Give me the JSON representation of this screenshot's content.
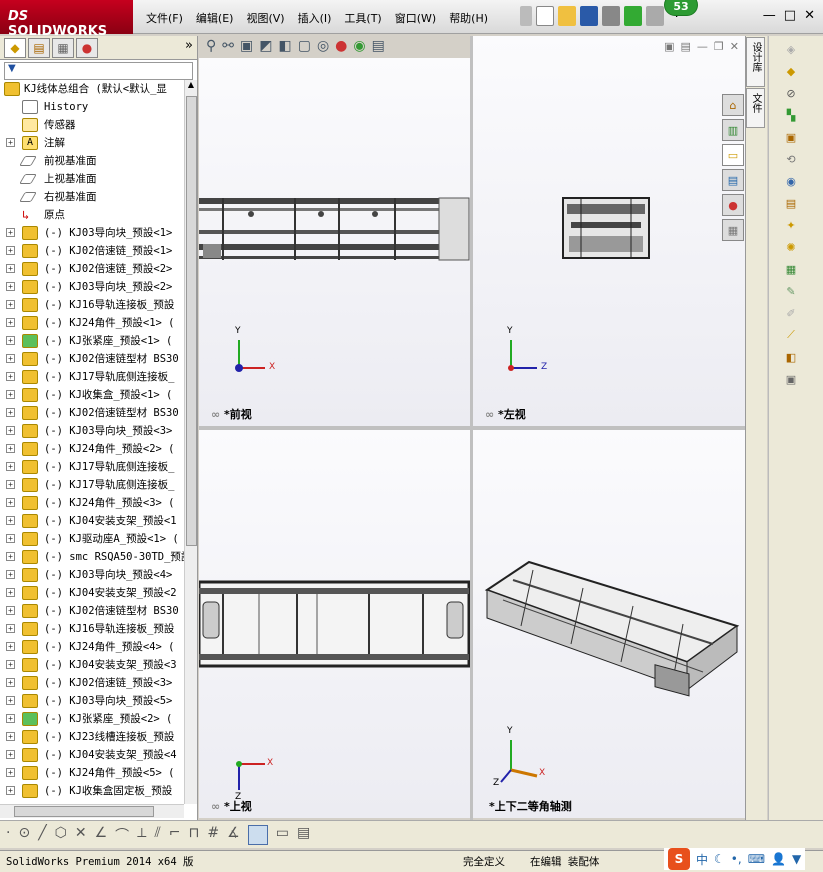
{
  "app": {
    "brand": "SOLIDWORKS",
    "brand_prefix": "DS",
    "notification_count": "53"
  },
  "menu": [
    "文件(F)",
    "编辑(E)",
    "视图(V)",
    "插入(I)",
    "工具(T)",
    "窗口(W)",
    "帮助(H)"
  ],
  "window_buttons": {
    "minimize": "—",
    "restore": "□",
    "close": "✕"
  },
  "sidebar": {
    "tabs": [
      "feature-manager",
      "property-manager",
      "configuration-manager",
      "display-manager"
    ],
    "expand": "»",
    "filter": "▼",
    "root": "KJ线体总组合  (默认<默认_显",
    "nodes": [
      {
        "label": "History",
        "type": "history"
      },
      {
        "label": "传感器",
        "type": "sensor"
      },
      {
        "label": "注解",
        "type": "annotation"
      },
      {
        "label": "前视基准面",
        "type": "plane"
      },
      {
        "label": "上视基准面",
        "type": "plane"
      },
      {
        "label": "右视基准面",
        "type": "plane"
      },
      {
        "label": "原点",
        "type": "origin"
      }
    ],
    "parts": [
      "(-) KJ03导向块_预設<1>",
      "(-) KJ02倍速链_预設<1>",
      "(-) KJ02倍速链_预設<2>",
      "(-) KJ03导向块_预設<2>",
      "(-) KJ16导轨连接板_预設",
      "(-) KJ24角件_预設<1> (",
      "(-) KJ张紧座_预設<1> (",
      "(-) KJ02倍速链型材 BS30",
      "(-) KJ17导轨底侧连接板_",
      "(-) KJ收集盒_预設<1> (",
      "(-) KJ02倍速链型材 BS30",
      "(-) KJ03导向块_预設<3>",
      "(-) KJ24角件_预設<2> (",
      "(-) KJ17导轨底侧连接板_",
      "(-) KJ17导轨底侧连接板_",
      "(-) KJ24角件_预設<3> (",
      "(-) KJ04安装支架_预設<1",
      "(-) KJ驱动座A_预設<1> (",
      "(-) smc RSQA50-30TD_预設",
      "(-) KJ03导向块_预設<4>",
      "(-) KJ04安装支架_预設<2",
      "(-) KJ02倍速链型材 BS30",
      "(-) KJ16导轨连接板_预設",
      "(-) KJ24角件_预設<4> (",
      "(-) KJ04安装支架_预設<3",
      "(-) KJ02倍速链_预設<3>",
      "(-) KJ03导向块_预設<5>",
      "(-) KJ张紧座_预設<2> (",
      "(-) KJ23线槽连接板_预設",
      "(-) KJ04安装支架_预設<4",
      "(-) KJ24角件_预設<5> (",
      "(-) KJ收集盒固定板_预設"
    ]
  },
  "viewports": {
    "front": "*前视",
    "left": "*左视",
    "top": "*上视",
    "iso": "*上下二等角轴测"
  },
  "axes": {
    "x": "X",
    "y": "Y",
    "z": "Z"
  },
  "task_pane_tabs": [
    "设计库",
    "文件"
  ],
  "status": {
    "product": "SolidWorks Premium 2014 x64 版",
    "definition": "完全定义",
    "mode": "在编辑 装配体"
  },
  "ime": {
    "logo": "S",
    "lang": "中"
  }
}
